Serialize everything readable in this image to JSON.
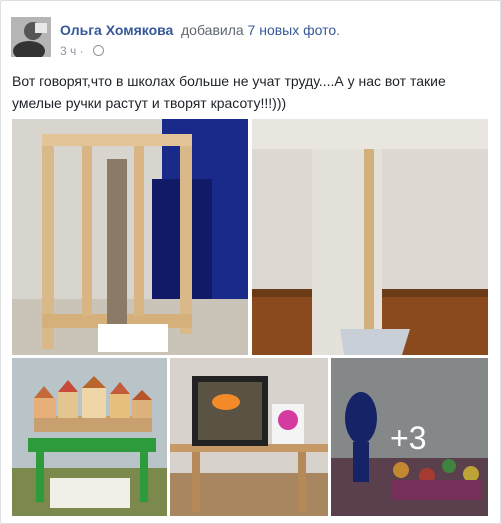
{
  "post": {
    "author": "Ольга Хомякова",
    "action_prefix": "добавила",
    "action_link": "7 новых фото",
    "action_suffix": ".",
    "time": "3 ч",
    "privacy_icon": "globe-icon",
    "text": "Вот говорят,что в школах больше не учат труду....А у нас вот такие умелые ручки растут и творят красоту!!!)))",
    "more_photos": "+3"
  },
  "colors": {
    "link": "#365899",
    "meta": "#90949c",
    "text": "#1d2129"
  }
}
